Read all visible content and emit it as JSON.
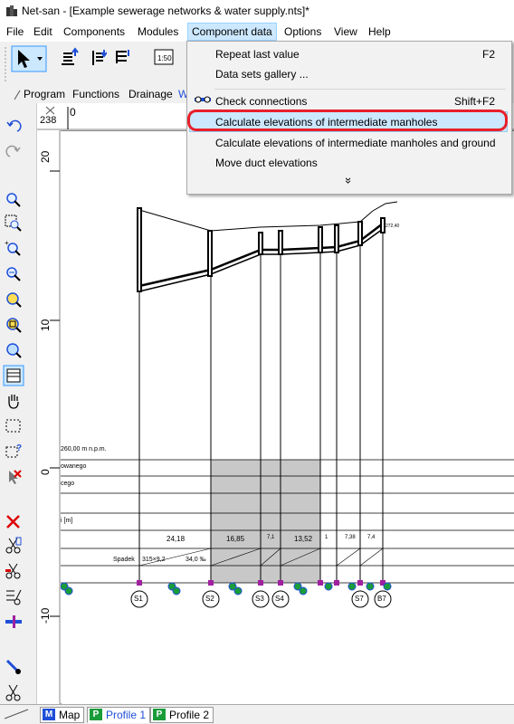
{
  "window": {
    "title": "Net-san - [Example sewerage networks & water supply.nts]*"
  },
  "menubar": {
    "items": [
      "File",
      "Edit",
      "Components",
      "Modules",
      "Component data",
      "Options",
      "View",
      "Help"
    ]
  },
  "dropdown": {
    "items": [
      {
        "label": "Repeat last value",
        "shortcut": "F2"
      },
      {
        "label": "Data sets gallery ..."
      },
      {
        "label": "Check connections",
        "shortcut": "Shift+F2"
      },
      {
        "label": "Calculate elevations of intermediate manholes",
        "highlighted": true
      },
      {
        "label": "Calculate elevations of intermediate manholes and ground"
      },
      {
        "label": "Move duct elevations"
      }
    ],
    "more_glyph": "»",
    "highlight_color": "#cce8ff",
    "annotation_color": "#e8202a"
  },
  "tabs": {
    "items": [
      "Program",
      "Functions",
      "Drainage",
      "W"
    ]
  },
  "ruler": {
    "corner_value": "238",
    "h_zero": "0",
    "v_labels": [
      "20",
      "10",
      "0",
      "-10"
    ]
  },
  "profile": {
    "row_labels": [
      "260,00 m n.p.m.",
      "owanego",
      "cego",
      "i [m]",
      "Spadek"
    ],
    "distances": [
      "24,18",
      "16,85",
      "7,1",
      "13,52",
      "1",
      "7,38",
      "7,4"
    ],
    "pipe_labels": [
      "315×9,2",
      "34,0 ‰"
    ],
    "manholes": [
      "S1",
      "S2",
      "S3",
      "S4",
      "S7",
      "B7"
    ],
    "top_label": "272,40"
  },
  "bottom_tabs": [
    {
      "icon": "M",
      "label": "Map",
      "color": "#1f4fd8"
    },
    {
      "icon": "P",
      "label": "Profile 1",
      "color": "#1a9c3a",
      "active": true
    },
    {
      "icon": "P",
      "label": "Profile 2",
      "color": "#1a9c3a"
    }
  ]
}
